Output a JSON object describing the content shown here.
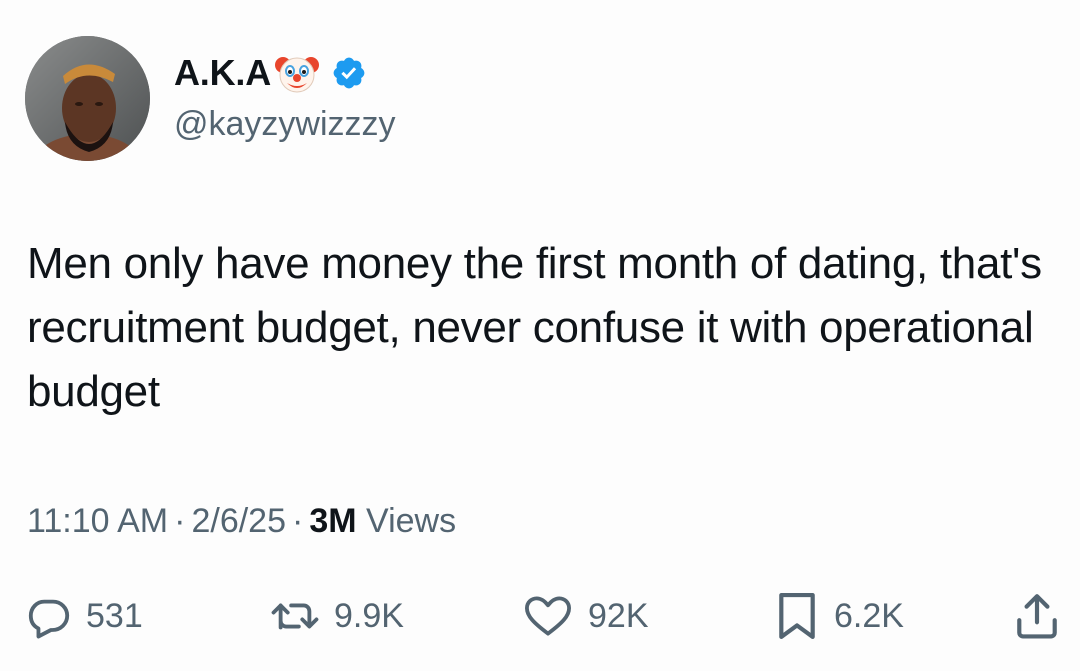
{
  "author": {
    "display_name": "A.K.A",
    "handle": "@kayzywizzzy",
    "verified": true,
    "name_emoji_icon": "clown-face-icon",
    "verified_icon": "verified-badge-icon",
    "verified_color": "#1d9bf0"
  },
  "tweet": {
    "text": "Men only have money the first month of dating, that's recruitment budget, never confuse it with operational budget",
    "time": "11:10 AM",
    "date": "2/6/25",
    "separator": "·",
    "views_count": "3M",
    "views_label": "Views"
  },
  "actions": {
    "reply": {
      "icon": "reply-bubble-icon",
      "count": "531"
    },
    "retweet": {
      "icon": "retweet-icon",
      "count": "9.9K"
    },
    "like": {
      "icon": "heart-icon",
      "count": "92K"
    },
    "bookmark": {
      "icon": "bookmark-icon",
      "count": "6.2K"
    },
    "share": {
      "icon": "share-icon"
    }
  },
  "colors": {
    "text_primary": "#0f1419",
    "text_secondary": "#536471",
    "background": "#fdfdfd"
  }
}
